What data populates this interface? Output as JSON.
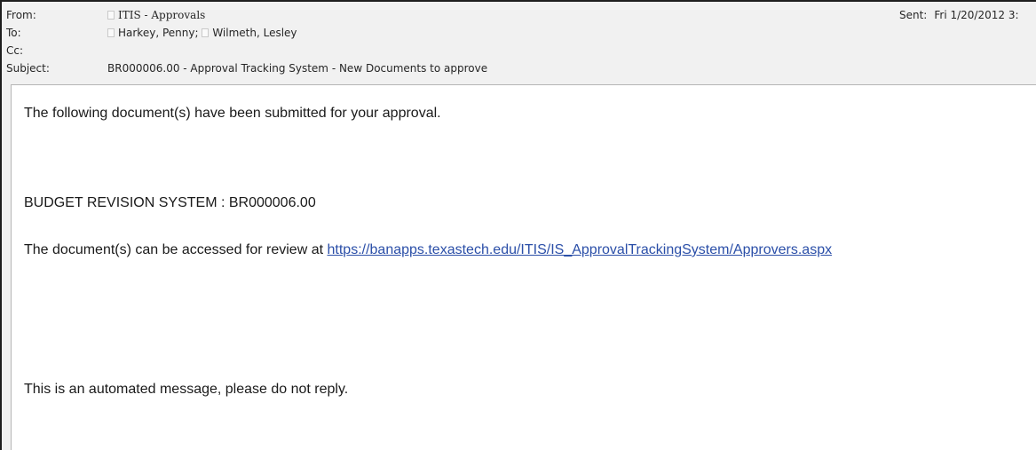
{
  "header": {
    "from_label": "From:",
    "from_value": "ITIS - Approvals",
    "to_label": "To:",
    "to_recipients": [
      "Harkey, Penny;",
      "Wilmeth, Lesley"
    ],
    "cc_label": "Cc:",
    "cc_value": "",
    "subject_label": "Subject:",
    "subject_value": "BR000006.00 - Approval Tracking System - New Documents to approve",
    "sent_label": "Sent:",
    "sent_value": "Fri 1/20/2012 3:"
  },
  "body": {
    "intro": "The following document(s) have been submitted for your approval.",
    "system_line": "BUDGET REVISION SYSTEM : BR000006.00",
    "access_text": "The document(s) can be accessed for review at ",
    "link": "https://banapps.texastech.edu/ITIS/IS_ApprovalTrackingSystem/Approvers.aspx",
    "footer": "This is an automated message, please do not reply."
  },
  "icons": {
    "recipient": "person-icon"
  }
}
